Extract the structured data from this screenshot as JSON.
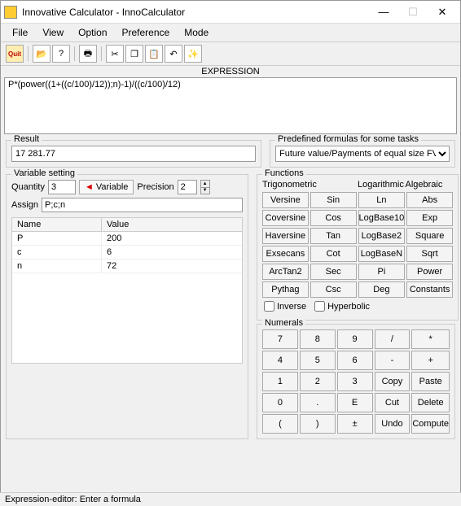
{
  "title": "Innovative Calculator - InnoCalculator",
  "menu": [
    "File",
    "View",
    "Option",
    "Preference",
    "Mode"
  ],
  "toolbar_icons": {
    "quit": "Quit",
    "open": "open-icon",
    "help": "?",
    "print": "print-icon",
    "cut": "✂",
    "copy": "❐",
    "paste": "📋",
    "undo": "↶",
    "wand": "✎"
  },
  "expression": {
    "header": "EXPRESSION",
    "value": "P*(power((1+((c/100)/12));n)-1)/((c/100)/12)"
  },
  "result": {
    "label": "Result",
    "value": "17 281.77"
  },
  "predef": {
    "label": "Predefined formulas for some tasks",
    "selected": "Future value/Payments of equal size FVn"
  },
  "var_setting": {
    "label": "Variable setting",
    "quantity_label": "Quantity",
    "quantity": "3",
    "variable_btn": "Variable",
    "precision_label": "Precision",
    "precision": "2",
    "assign_label": "Assign",
    "assign": "P;c;n",
    "table": {
      "headers": [
        "Name",
        "Value"
      ],
      "rows": [
        {
          "name": "P",
          "value": "200"
        },
        {
          "name": "c",
          "value": "6"
        },
        {
          "name": "n",
          "value": "72"
        }
      ]
    }
  },
  "functions": {
    "label": "Functions",
    "headers": [
      "Trigonometric",
      "Logarithmic",
      "Algebraic"
    ],
    "buttons": [
      "Versine",
      "Sin",
      "Ln",
      "Abs",
      "Coversine",
      "Cos",
      "LogBase10",
      "Exp",
      "Haversine",
      "Tan",
      "LogBase2",
      "Square",
      "Exsecans",
      "Cot",
      "LogBaseN",
      "Sqrt",
      "ArcTan2",
      "Sec",
      "Pi",
      "Power",
      "Pythag",
      "Csc",
      "Deg",
      "Constants"
    ],
    "inverse": "Inverse",
    "hyperbolic": "Hyperbolic"
  },
  "numerals": {
    "label": "Numerals",
    "buttons": [
      "7",
      "8",
      "9",
      "/",
      "*",
      "4",
      "5",
      "6",
      "-",
      "+",
      "1",
      "2",
      "3",
      "Copy",
      "Paste",
      "0",
      ".",
      "E",
      "Cut",
      "Delete",
      "(",
      ")",
      "±",
      "Undo",
      "Compute"
    ]
  },
  "status": "Expression-editor: Enter a formula"
}
